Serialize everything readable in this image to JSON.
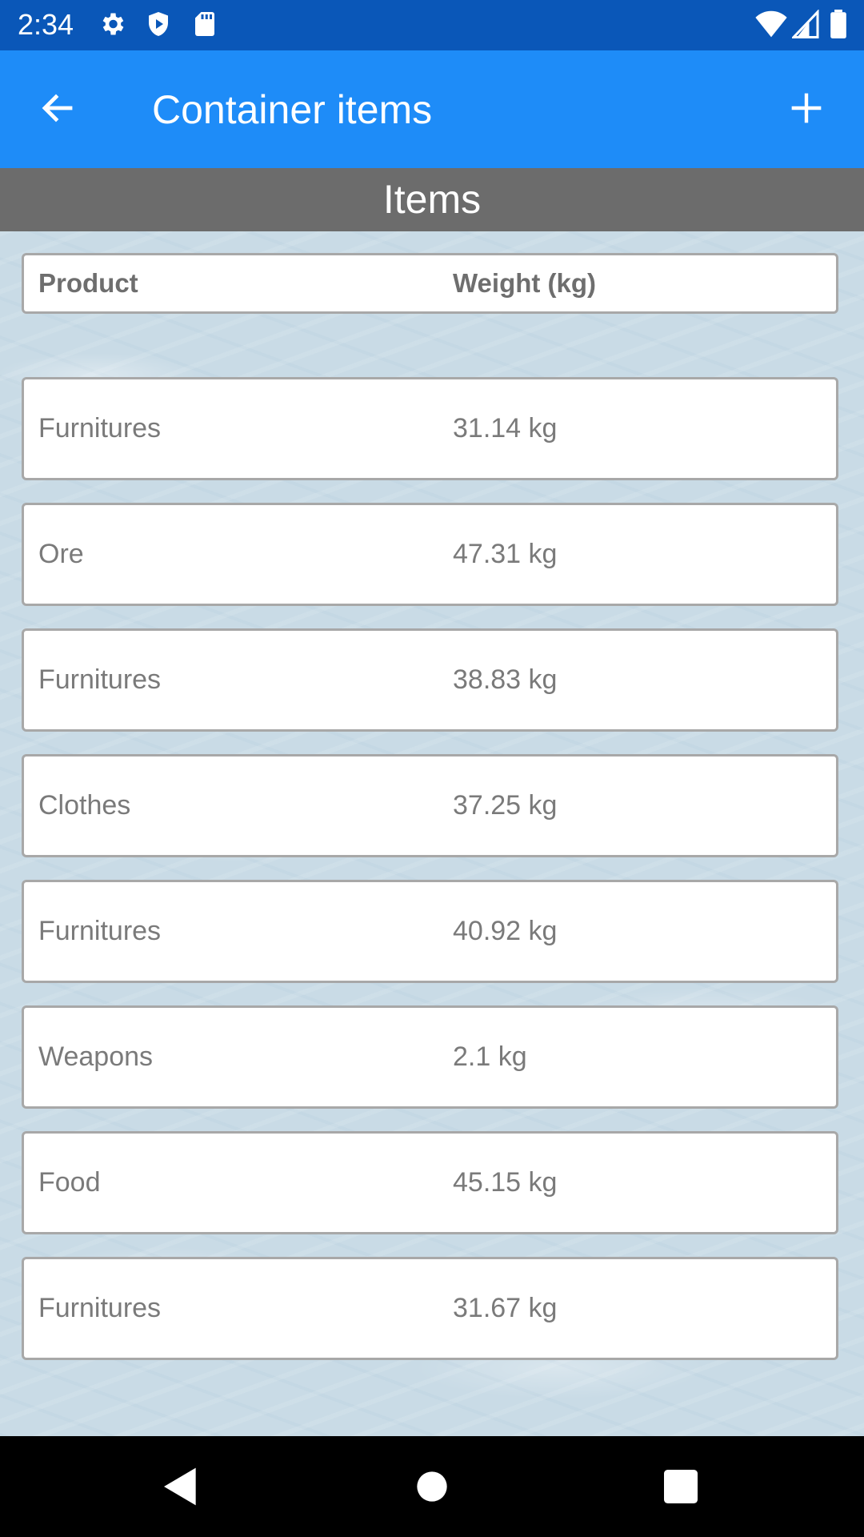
{
  "status_bar": {
    "time": "2:34",
    "icons": [
      "settings-icon",
      "shield-icon",
      "sd-card-icon",
      "wifi-icon",
      "signal-icon",
      "battery-icon"
    ]
  },
  "app_bar": {
    "title": "Container items",
    "back_icon": "back-arrow-icon",
    "add_icon": "plus-icon"
  },
  "section": {
    "title": "Items"
  },
  "table": {
    "headers": {
      "product": "Product",
      "weight": "Weight (kg)"
    },
    "rows": [
      {
        "product": "Furnitures",
        "weight": "31.14 kg"
      },
      {
        "product": "Ore",
        "weight": "47.31 kg"
      },
      {
        "product": "Furnitures",
        "weight": "38.83 kg"
      },
      {
        "product": "Clothes",
        "weight": "37.25 kg"
      },
      {
        "product": "Furnitures",
        "weight": "40.92 kg"
      },
      {
        "product": "Weapons",
        "weight": "2.1 kg"
      },
      {
        "product": "Food",
        "weight": "45.15 kg"
      },
      {
        "product": "Furnitures",
        "weight": "31.67 kg"
      }
    ]
  },
  "nav_bar": {
    "icons": [
      "nav-back-icon",
      "nav-home-icon",
      "nav-recents-icon"
    ]
  },
  "colors": {
    "status_bar": "#0a57b8",
    "app_bar": "#1e8cf8",
    "section_header": "#6c6c6c",
    "card_border": "#a8a8a8",
    "text_gray": "#7a7a7a"
  }
}
